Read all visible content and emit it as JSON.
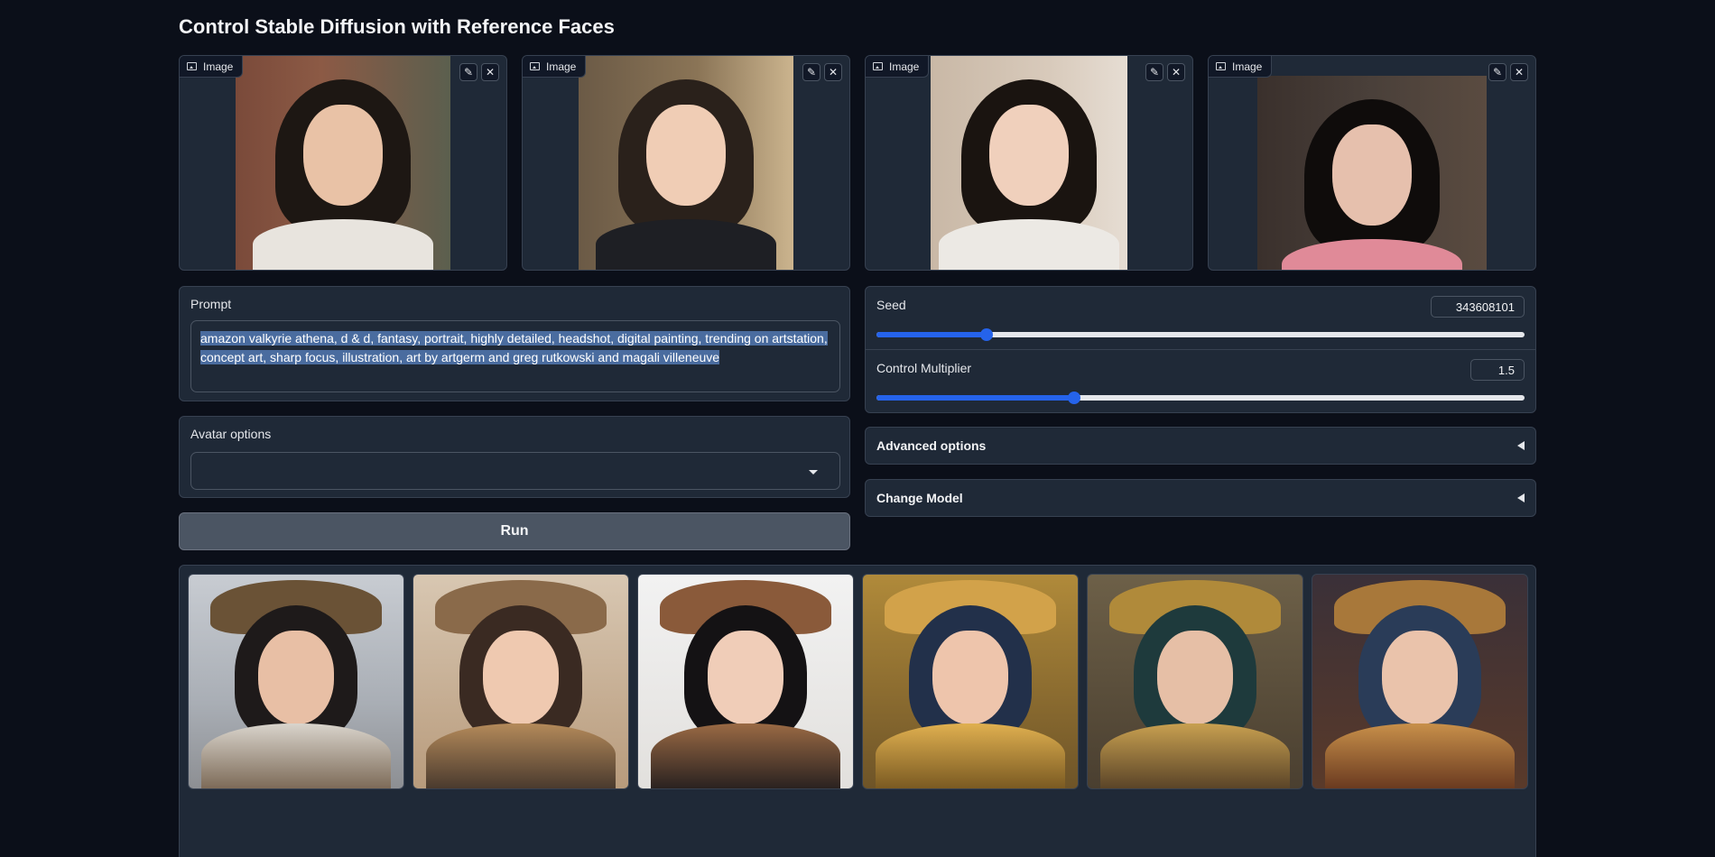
{
  "header": {
    "title": "Control Stable Diffusion with Reference Faces"
  },
  "reference_images": [
    {
      "label": "Image",
      "icon": "image-icon"
    },
    {
      "label": "Image",
      "icon": "image-icon"
    },
    {
      "label": "Image",
      "icon": "image-icon"
    },
    {
      "label": "Image",
      "icon": "image-icon"
    }
  ],
  "prompt": {
    "label": "Prompt",
    "value": "amazon valkyrie athena, d & d, fantasy, portrait, highly detailed, headshot, digital painting, trending on artstation, concept art, sharp focus, illustration, art by artgerm and greg rutkowski and magali villeneuve"
  },
  "avatar_options": {
    "label": "Avatar options",
    "value": ""
  },
  "run_button": {
    "label": "Run"
  },
  "seed": {
    "label": "Seed",
    "value": "343608101",
    "fraction": 0.17
  },
  "control_multiplier": {
    "label": "Control Multiplier",
    "value": "1.5",
    "fraction": 0.305
  },
  "advanced_options": {
    "label": "Advanced options"
  },
  "change_model": {
    "label": "Change Model"
  },
  "gallery": {
    "count": 6
  },
  "colors": {
    "accent": "#2563eb",
    "background": "#0b0f19",
    "panel": "#1f2937",
    "border": "#374151"
  }
}
